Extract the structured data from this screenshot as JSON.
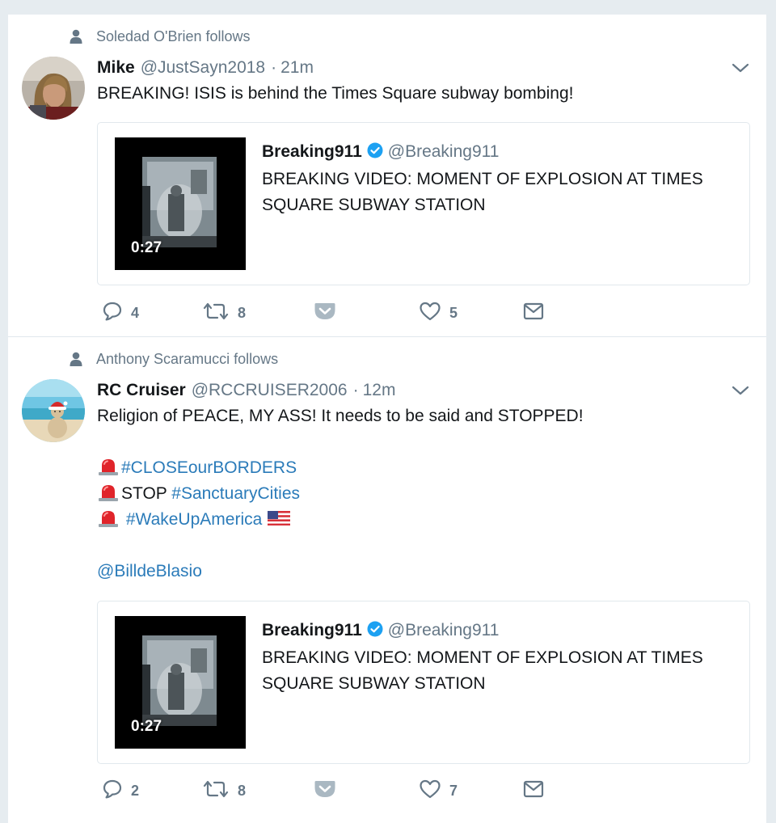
{
  "tweets": [
    {
      "context": "Soledad O'Brien follows",
      "name": "Mike",
      "handle": "@JustSayn2018",
      "separator": "·",
      "time": "21m",
      "text": "BREAKING! ISIS is behind the Times Square subway bombing!",
      "quoted": {
        "name": "Breaking911",
        "handle": "@Breaking911",
        "text_line1": "BREAKING VIDEO: MOMENT OF EXPLOSION AT TIMES",
        "text_line2": "SQUARE SUBWAY STATION",
        "duration": "0:27"
      },
      "replies": "4",
      "retweets": "8",
      "likes": "5"
    },
    {
      "context": "Anthony Scaramucci follows",
      "name": "RC Cruiser",
      "handle": "@RCCRUISER2006",
      "separator": "·",
      "time": "12m",
      "text_line1": "Religion of PEACE, MY ASS! It needs to be said and STOPPED!",
      "hashtag1": "#CLOSEourBORDERS",
      "stop_text": "STOP ",
      "hashtag2": "#SanctuaryCities",
      "hashtag3": "#WakeUpAmerica",
      "mention": "@BilldeBlasio",
      "quoted": {
        "name": "Breaking911",
        "handle": "@Breaking911",
        "text_line1": "BREAKING VIDEO: MOMENT OF EXPLOSION AT TIMES",
        "text_line2": "SQUARE SUBWAY STATION",
        "duration": "0:27"
      },
      "replies": "2",
      "retweets": "8",
      "likes": "7"
    }
  ],
  "icons": {
    "context": "person-icon",
    "caret": "chevron-down-icon",
    "verified": "verified-badge-icon",
    "reply": "reply-icon",
    "retweet": "retweet-icon",
    "pocket": "pocket-icon",
    "like": "heart-icon",
    "message": "envelope-icon",
    "siren": "rotating-light-emoji",
    "flag": "us-flag-emoji"
  },
  "colors": {
    "link": "#2b7bb9",
    "secondary": "#657786",
    "verified": "#1da1f2",
    "background": "#e6ecf0",
    "pocket": "#aab8c2"
  }
}
